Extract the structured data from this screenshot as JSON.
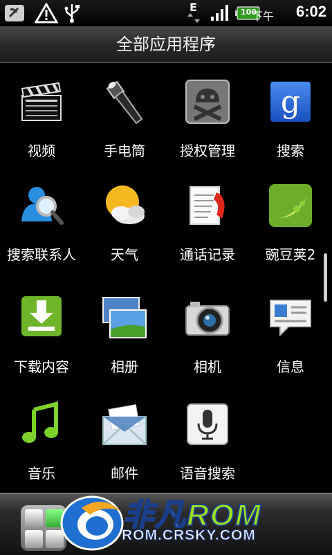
{
  "status_bar": {
    "ampm": "下午",
    "time": "6:02",
    "battery": "100",
    "network": "E",
    "icons": [
      "phone-mute-icon",
      "warning-icon",
      "usb-icon",
      "data-arrows-icon",
      "signal-icon",
      "battery-icon"
    ]
  },
  "title": "全部应用程序",
  "apps": [
    {
      "label": "视频",
      "icon": "clapperboard-icon"
    },
    {
      "label": "手电筒",
      "icon": "flashlight-icon"
    },
    {
      "label": "授权管理",
      "icon": "android-skull-icon"
    },
    {
      "label": "搜索",
      "icon": "google-search-icon"
    },
    {
      "label": "搜索联系人",
      "icon": "contact-search-icon"
    },
    {
      "label": "天气",
      "icon": "weather-sun-cloud-icon"
    },
    {
      "label": "通话记录",
      "icon": "call-log-icon"
    },
    {
      "label": "豌豆荚2",
      "icon": "peapod-icon"
    },
    {
      "label": "下载内容",
      "icon": "download-icon"
    },
    {
      "label": "相册",
      "icon": "gallery-icon"
    },
    {
      "label": "相机",
      "icon": "camera-icon"
    },
    {
      "label": "信息",
      "icon": "message-icon"
    },
    {
      "label": "音乐",
      "icon": "music-note-icon"
    },
    {
      "label": "邮件",
      "icon": "mail-icon"
    },
    {
      "label": "语音搜索",
      "icon": "microphone-icon"
    }
  ],
  "watermark": {
    "name_cn": "非凡",
    "name_en": "ROM",
    "url": "ROM.CRSKY.COM"
  }
}
